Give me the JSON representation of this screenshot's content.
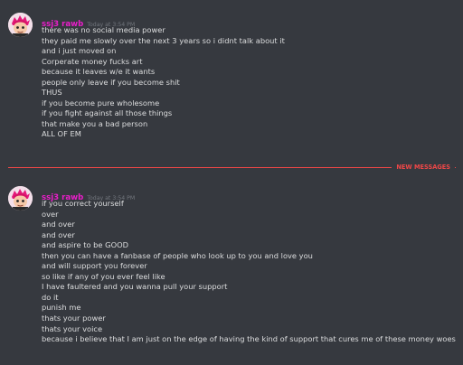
{
  "messages": [
    {
      "username": "ssj3 rawb",
      "timestamp": "Today at 3:54 PM",
      "lines": [
        "there was no social media power",
        "they paid me slowly over the next 3 years so i didnt talk about it",
        "and i just moved on",
        "Corperate money fucks art",
        "because it leaves w/e it wants",
        "people only leave if you become shit",
        "THUS",
        "if you become pure wholesome",
        "if you fight against all those things",
        "that make you a bad person",
        "ALL OF EM"
      ]
    },
    {
      "username": "ssj3 rawb",
      "timestamp": "Today at 3:54 PM",
      "lines": [
        "if you correct yourself",
        "over",
        "and over",
        "and over",
        "and aspire to be GOOD",
        "then you can have a fanbase of people who look up to you and love you",
        "and will support you forever",
        "so like if any of you ever feel like",
        "I have faultered and you wanna pull your support",
        "do it",
        "punish me",
        "thats your power",
        "thats your voice",
        "because i believe that I am just on the edge of having the kind of support that cures me of these money woes"
      ]
    }
  ],
  "divider": {
    "label": "NEW MESSAGES"
  },
  "colors": {
    "background": "#36393f",
    "username": "#e91ec9",
    "text": "#dcddde",
    "timestamp": "#72767d",
    "new_messages": "#f04747"
  }
}
